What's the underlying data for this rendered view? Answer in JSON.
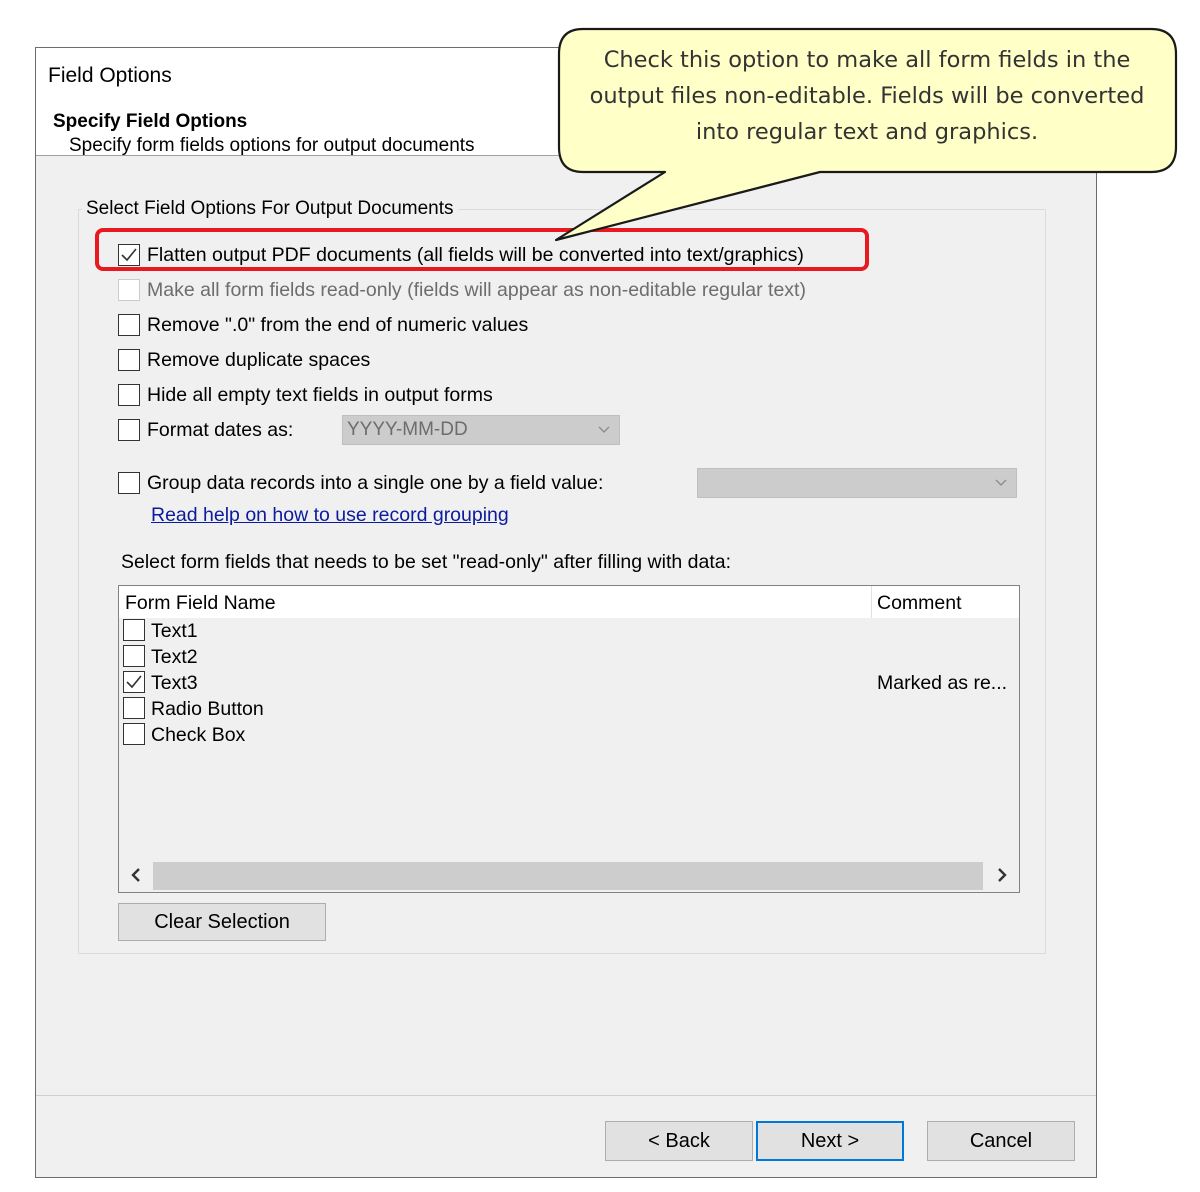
{
  "dialog": {
    "window_title": "Field Options",
    "header_title": "Specify Field Options",
    "header_subtitle": "Specify form fields options for output documents"
  },
  "group": {
    "title": "Select Field Options For Output Documents",
    "options": [
      {
        "label": "Flatten output PDF documents (all fields will be converted into text/graphics)",
        "checked": true,
        "enabled": true
      },
      {
        "label": "Make all form fields read-only (fields will appear as non-editable regular text)",
        "checked": false,
        "enabled": false
      },
      {
        "label": "Remove \".0\" from the end of numeric values",
        "checked": false,
        "enabled": true
      },
      {
        "label": "Remove duplicate spaces",
        "checked": false,
        "enabled": true
      },
      {
        "label": "Hide all empty text fields in output forms",
        "checked": false,
        "enabled": true
      },
      {
        "label": "Format dates as:",
        "checked": false,
        "enabled": true
      },
      {
        "label": "Group data records into a single one by a field value:",
        "checked": false,
        "enabled": true
      }
    ],
    "date_format_value": "YYYY-MM-DD",
    "group_field_value": "",
    "help_link": "Read help on how to use record grouping",
    "fields_heading": "Select form fields that needs to be set \"read-only\" after filling with data:",
    "list": {
      "columns": [
        "Form Field Name",
        "Comment"
      ],
      "rows": [
        {
          "name": "Text1",
          "checked": false,
          "comment": ""
        },
        {
          "name": "Text2",
          "checked": false,
          "comment": ""
        },
        {
          "name": "Text3",
          "checked": true,
          "comment": "Marked as re..."
        },
        {
          "name": "Radio Button",
          "checked": false,
          "comment": ""
        },
        {
          "name": "Check Box",
          "checked": false,
          "comment": ""
        }
      ]
    },
    "clear_button": "Clear Selection"
  },
  "footer": {
    "back": "< Back",
    "next": "Next >",
    "cancel": "Cancel"
  },
  "callout": {
    "text": "Check this option to make all form fields in the output files non-editable. Fields will be converted into regular text and graphics.",
    "fill": "#ffffc8",
    "highlight_color": "#e8191f"
  },
  "colors": {
    "dialog_bg": "#f0f0f0",
    "link": "#0b1b9e",
    "accent": "#0078d7"
  }
}
